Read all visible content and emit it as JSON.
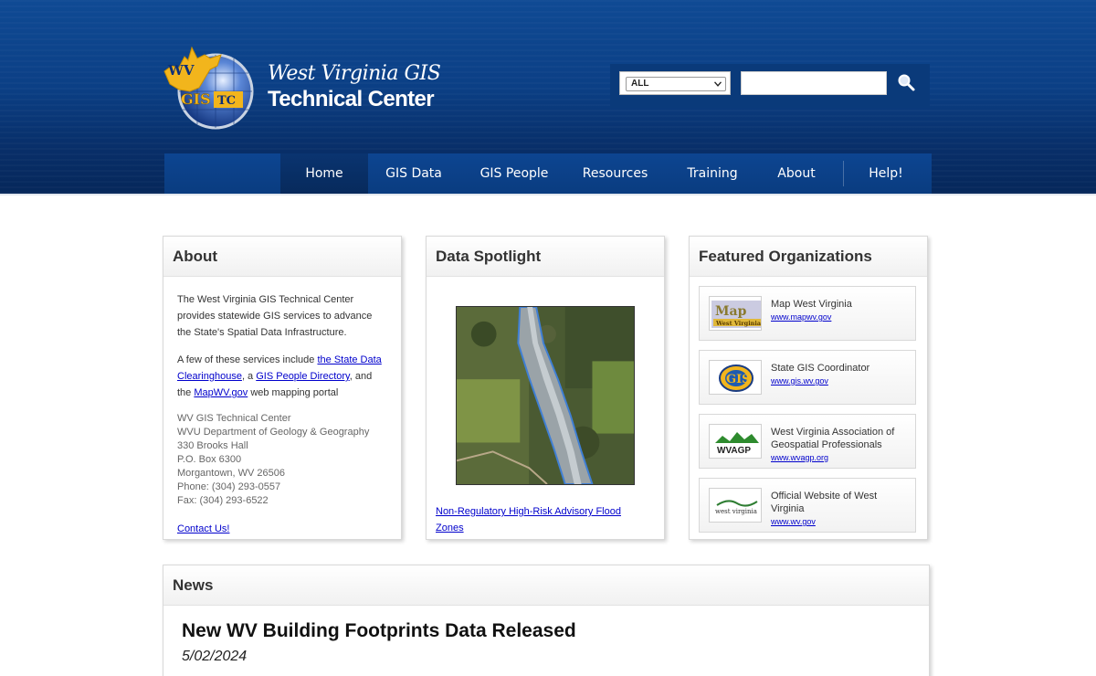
{
  "brand": {
    "logo_letters_wv": "WV",
    "logo_letters_gis": "GIS",
    "logo_letters_tc": "TC",
    "line1": "West Virginia GIS",
    "line2": "Technical Center"
  },
  "search": {
    "scope_value": "ALL",
    "query_value": ""
  },
  "nav": {
    "items": [
      {
        "label": "Home"
      },
      {
        "label": "GIS Data"
      },
      {
        "label": "GIS People"
      },
      {
        "label": "Resources"
      },
      {
        "label": "Training"
      },
      {
        "label": "About"
      },
      {
        "label": "Help!"
      }
    ]
  },
  "about": {
    "title": "About",
    "p1": "The West Virginia GIS Technical Center provides statewide GIS services to advance the State's Spatial Data Infrastructure.",
    "p2_pre": "A few of these services include ",
    "p2_link1": "the State Data Clearinghouse",
    "p2_mid1": ", a ",
    "p2_link2": "GIS People Directory",
    "p2_mid2": ", and the ",
    "p2_link3": "MapWV.gov",
    "p2_post": " web mapping portal",
    "address": [
      "WV GIS Technical Center",
      "WVU Department of Geology & Geography",
      "330 Brooks Hall",
      "P.O. Box 6300",
      "Morgantown, WV 26506",
      "Phone: (304) 293-0557",
      "Fax: (304) 293-6522"
    ],
    "contact_link": "Contact Us!"
  },
  "spotlight": {
    "title": "Data Spotlight",
    "link": "Non-Regulatory High-Risk Advisory Flood Zones"
  },
  "orgs": {
    "title": "Featured Organizations",
    "items": [
      {
        "name": "Map West Virginia",
        "url": "www.mapwv.gov",
        "logo_text": "Map West Virginia"
      },
      {
        "name": "State GIS Coordinator",
        "url": "www.gis.wv.gov",
        "logo_text": "GIS"
      },
      {
        "name": "West Virginia Association of Geospatial Professionals",
        "url": "www.wvagp.org",
        "logo_text": "WVAGP"
      },
      {
        "name": "Official Website of West Virginia",
        "url": "www.wv.gov",
        "logo_text": "west virginia"
      }
    ]
  },
  "news": {
    "title": "News",
    "headline": "New WV Building Footprints Data Released",
    "date": "5/02/2024"
  },
  "colors": {
    "header_blue": "#0b3f85",
    "link_blue": "#0000cc",
    "logo_gold": "#f2b51c"
  }
}
